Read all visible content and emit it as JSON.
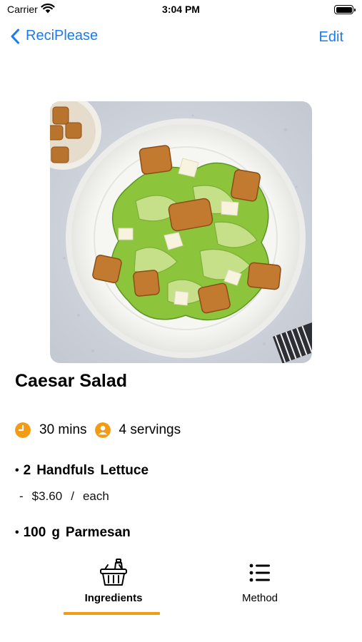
{
  "status_bar": {
    "carrier": "Carrier",
    "time": "3:04 PM"
  },
  "nav": {
    "back_label": "ReciPlease",
    "edit_label": "Edit",
    "accent_color": "#1a7cf0"
  },
  "recipe": {
    "title": "Caesar Salad",
    "time": "30 mins",
    "servings": "4 servings",
    "image": "caesar-salad-photo"
  },
  "ingredients": [
    {
      "bullet": "•",
      "amount": "2",
      "unit": "Handfuls",
      "name": "Lettuce",
      "price_dash": "-",
      "price": "$3.60",
      "price_sep": "/",
      "price_unit": "each"
    },
    {
      "bullet": "•",
      "amount": "100",
      "unit": "g",
      "name": "Parmesan"
    }
  ],
  "tabs": {
    "ingredients_label": "Ingredients",
    "method_label": "Method",
    "active": "Ingredients",
    "indicator_color": "#f39b14"
  },
  "icons": {
    "clock": "clock-icon",
    "servings": "person-icon",
    "ingredients_tab": "basket-icon",
    "method_tab": "list-icon"
  }
}
